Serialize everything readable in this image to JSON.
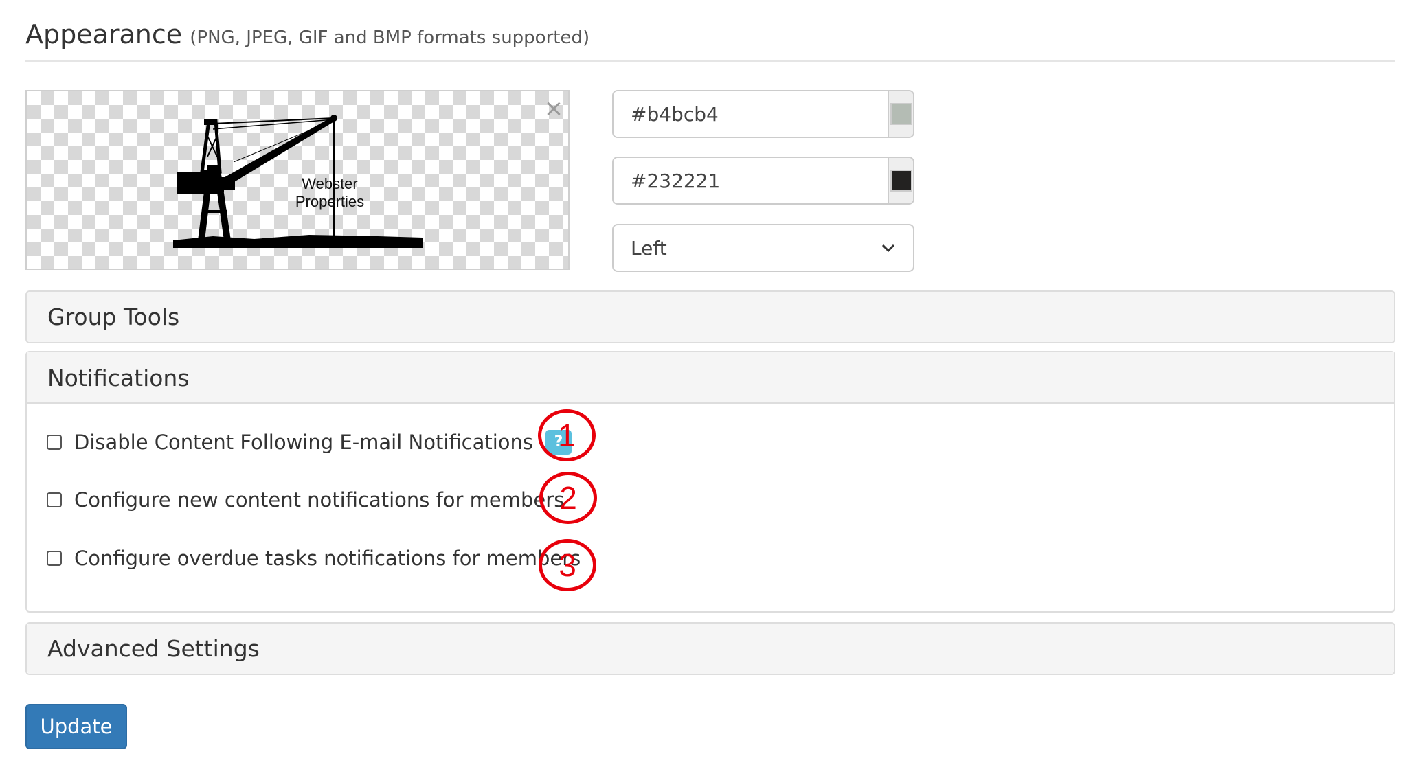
{
  "appearance": {
    "title": "Appearance",
    "subtitle": "(PNG, JPEG, GIF and BMP formats supported)",
    "logo": {
      "line1": "Webster",
      "line2": "Properties",
      "remove_icon": "close-icon"
    },
    "primary_color": {
      "value": "#b4bcb4",
      "swatch": "#b4bcb4"
    },
    "secondary_color": {
      "value": "#232221",
      "swatch": "#232221"
    },
    "alignment": {
      "selected": "Left"
    }
  },
  "panels": {
    "group_tools": {
      "title": "Group Tools"
    },
    "notifications": {
      "title": "Notifications",
      "options": [
        {
          "label": "Disable Content Following E-mail Notifications",
          "checked": false,
          "help": "?"
        },
        {
          "label": "Configure new content notifications for members",
          "checked": false
        },
        {
          "label": "Configure overdue tasks notifications for members",
          "checked": false
        }
      ]
    },
    "advanced_settings": {
      "title": "Advanced Settings"
    }
  },
  "callouts": [
    "1",
    "2",
    "3"
  ],
  "update_button": {
    "label": "Update"
  },
  "colors": {
    "primary_button": "#337ab7",
    "help_badge": "#5bc0de",
    "callout": "#e8000b"
  }
}
